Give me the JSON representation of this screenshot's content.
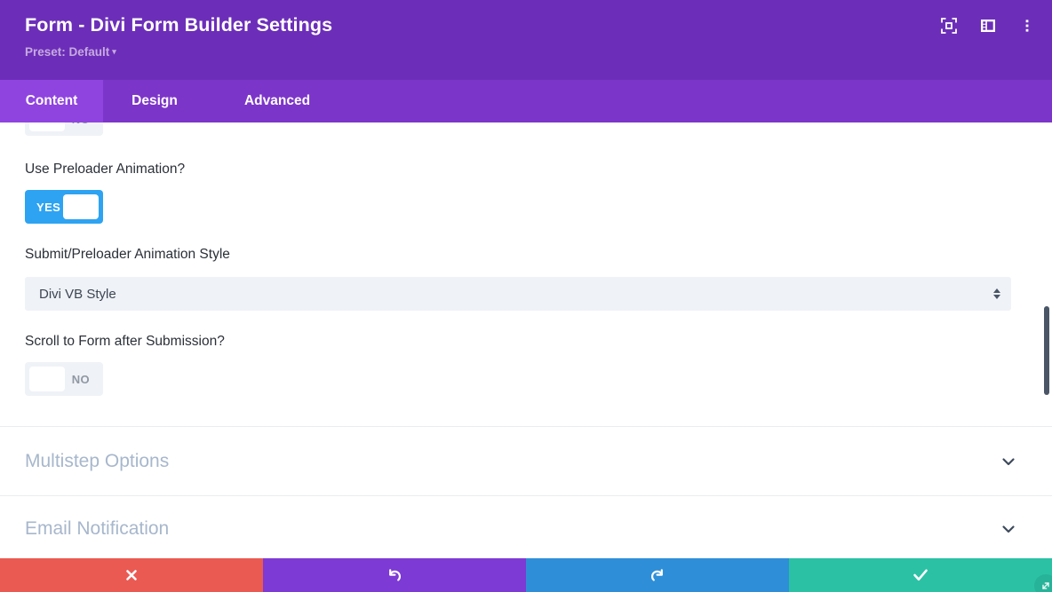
{
  "header": {
    "title": "Form - Divi Form Builder Settings",
    "preset_label": "Preset: Default",
    "preset_caret": "▾",
    "icons": [
      {
        "name": "focus-icon",
        "label": "Focus"
      },
      {
        "name": "layout-panel-icon",
        "label": "Layout"
      },
      {
        "name": "more-vertical-icon",
        "label": "More"
      }
    ]
  },
  "tabs": [
    {
      "id": "content",
      "label": "Content",
      "active": true
    },
    {
      "id": "design",
      "label": "Design",
      "active": false
    },
    {
      "id": "advanced",
      "label": "Advanced",
      "active": false
    }
  ],
  "fields": {
    "clipped_toggle": {
      "value": "NO"
    },
    "preloader": {
      "label": "Use Preloader Animation?",
      "value": "YES"
    },
    "animation_style": {
      "label": "Submit/Preloader Animation Style",
      "value": "Divi VB Style",
      "options": [
        "Divi VB Style"
      ]
    },
    "scroll_to_form": {
      "label": "Scroll to Form after Submission?",
      "value": "NO"
    }
  },
  "sections": [
    {
      "id": "multistep-options",
      "title": "Multistep Options",
      "expanded": false,
      "chevron": "chevron-down-icon"
    },
    {
      "id": "email-notification",
      "title": "Email Notification",
      "expanded": false,
      "chevron": "chevron-down-icon"
    }
  ],
  "footer": {
    "buttons": [
      {
        "id": "cancel",
        "icon": "close-icon",
        "color": "#ea5a53"
      },
      {
        "id": "undo",
        "icon": "undo-icon",
        "color": "#7d3ad4"
      },
      {
        "id": "redo",
        "icon": "redo-icon",
        "color": "#2e8fd8"
      },
      {
        "id": "save",
        "icon": "checkmark-icon",
        "color": "#2bc1a5"
      }
    ]
  },
  "colors": {
    "header_purple": "#6c2eb9",
    "tabbar_purple": "#7c35c9",
    "active_tab_purple": "#8f44e0",
    "toggle_on_blue": "#2ea3f2",
    "field_bg": "#eff2f6",
    "section_title": "#a7b7cc"
  },
  "scrollbar": {
    "visible": true
  }
}
